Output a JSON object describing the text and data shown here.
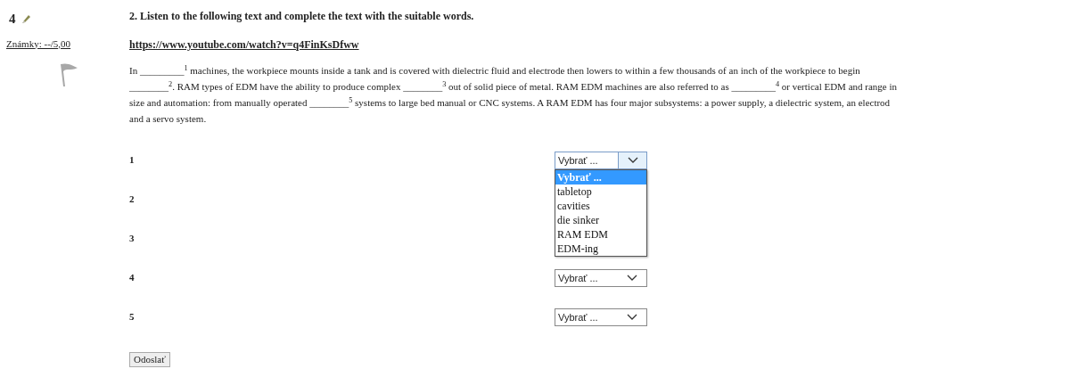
{
  "question": {
    "number": "4",
    "grade": "Známky: --/5,00"
  },
  "title": "2. Listen to the following text and complete the text with the suitable words.",
  "link": "https://www.youtube.com/watch?v=q4FinKsDfww",
  "paragraph": "In _________$^{1}$ machines, the workpiece mounts inside a tank and is covered with dielectric fluid and electrode then lowers to within a few thousands of an inch of the workpiece to begin\n________$^{2}$. RAM types of EDM have the ability to produce complex ________$^{3}$ out of solid piece of metal. RAM EDM machines are also referred to as _________$^{4}$ or vertical EDM and range in\nsize and automation: from manually operated ________$^{5}$ systems to large bed manual or CNC systems. A RAM EDM has four major subsystems: a power supply, a dielectric system, an electrod\nand a servo system.",
  "answers": [
    {
      "number": "1",
      "value": "Vybrať ...",
      "open": true,
      "options": [
        {
          "label": "Vybrať ...",
          "selected": true
        },
        {
          "label": "tabletop",
          "selected": false
        },
        {
          "label": "cavities",
          "selected": false
        },
        {
          "label": "die sinker",
          "selected": false
        },
        {
          "label": "RAM EDM",
          "selected": false
        },
        {
          "label": "EDM-ing",
          "selected": false
        }
      ]
    },
    {
      "number": "2"
    },
    {
      "number": "3"
    },
    {
      "number": "4",
      "value": "Vybrať ...",
      "open": false
    },
    {
      "number": "5",
      "value": "Vybrať ...",
      "open": false
    }
  ],
  "submit": "Odoslať"
}
